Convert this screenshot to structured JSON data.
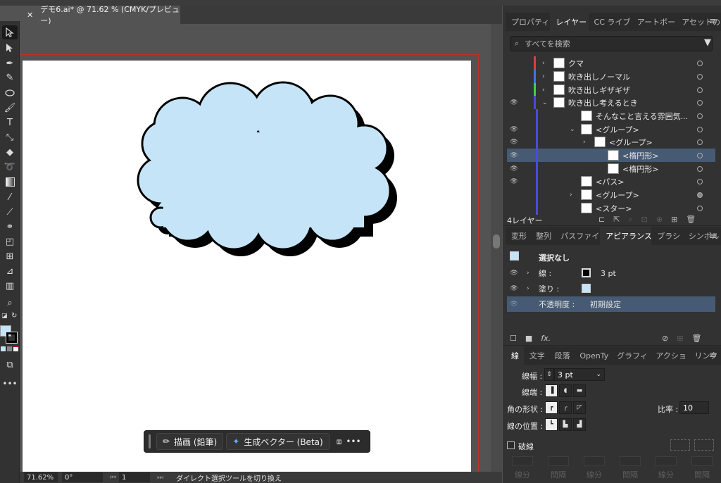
{
  "document": {
    "tab_title": "デモ6.ai* @ 71.62 % (CMYK/プレビュー)"
  },
  "colors": {
    "accent": "#465a74",
    "bubble_fill": "#c5e4f7",
    "bleed": "#c0302a",
    "panel": "#323232"
  },
  "tools": [
    "selection-tool",
    "direct-selection-tool",
    "pen-tool",
    "curvature-tool",
    "ellipse-tool",
    "paintbrush-tool",
    "type-tool",
    "free-transform-tool",
    "eraser-tool",
    "lasso-tool",
    "gradient-tool",
    "eyedropper-tool",
    "blend-tool",
    "shape-builder-tool",
    "artboard-tool",
    "slice-tool",
    "column-graph-tool",
    "zoom-tool"
  ],
  "context_bar": {
    "draw_label": "描画 (鉛筆)",
    "generate_label": "生成ベクター (Beta)",
    "more_label": "•••"
  },
  "status": {
    "zoom": "71.62%",
    "rotation": "0°",
    "artboard": "1",
    "tool_hint": "ダイレクト選択ツールを切り換え"
  },
  "layers_panel": {
    "tabs": [
      "プロパティ",
      "レイヤー",
      "CC ライブ",
      "アートボー",
      "アセットの"
    ],
    "active_tab": "レイヤー",
    "search_placeholder": "すべてを検索",
    "rows": [
      {
        "name": "クマ",
        "visible": false,
        "color": "#d84040"
      },
      {
        "name": "吹き出しノーマル",
        "visible": false,
        "color": "#4a6fe0"
      },
      {
        "name": "吹き出しギザギザ",
        "visible": false,
        "color": "#3fd04a"
      },
      {
        "name": "吹き出し考えるとき",
        "visible": true,
        "color": "#4a4adc"
      },
      {
        "name": "そんなこと言える雰囲気...",
        "visible": false,
        "color": "#4a4adc"
      },
      {
        "name": "<グループ>",
        "visible": true,
        "color": "#4a4adc"
      },
      {
        "name": "<グループ>",
        "visible": true,
        "color": "#4a4adc"
      },
      {
        "name": "<楕円形>",
        "visible": true,
        "color": "#4a4adc",
        "selected": true
      },
      {
        "name": "<楕円形>",
        "visible": true,
        "color": "#4a4adc"
      },
      {
        "name": "<パス>",
        "visible": true,
        "color": "#4a4adc"
      },
      {
        "name": "<グループ>",
        "visible": false,
        "color": "#4a4adc"
      },
      {
        "name": "<スター>",
        "visible": false,
        "color": "#4a4adc"
      }
    ],
    "count_label": "4レイヤー"
  },
  "appearance_panel": {
    "tabs": [
      "変形",
      "整列",
      "パスファイ",
      "アピアランス",
      "ブラシ",
      "シンボル"
    ],
    "active_tab": "アピアランス",
    "title": "選択なし",
    "stroke_label": "線 :",
    "stroke_value": "3 pt",
    "fill_label": "塗り :",
    "opacity_label": "不透明度 :",
    "opacity_value": "初期設定",
    "fx_label": "fx."
  },
  "stroke_panel": {
    "tabs": [
      "線",
      "文字",
      "段落",
      "OpenTy",
      "グラフィ",
      "アクショ",
      "リンク"
    ],
    "active_tab": "線",
    "width_label": "線幅 :",
    "width_value": "3 pt",
    "cap_label": "線端 :",
    "corner_label": "角の形状 :",
    "ratio_label": "比率 :",
    "ratio_value": "10",
    "align_label": "線の位置 :",
    "dashed_label": "破線",
    "dash_labels": [
      "線分",
      "間隔",
      "線分",
      "間隔",
      "線分",
      "間隔"
    ]
  }
}
